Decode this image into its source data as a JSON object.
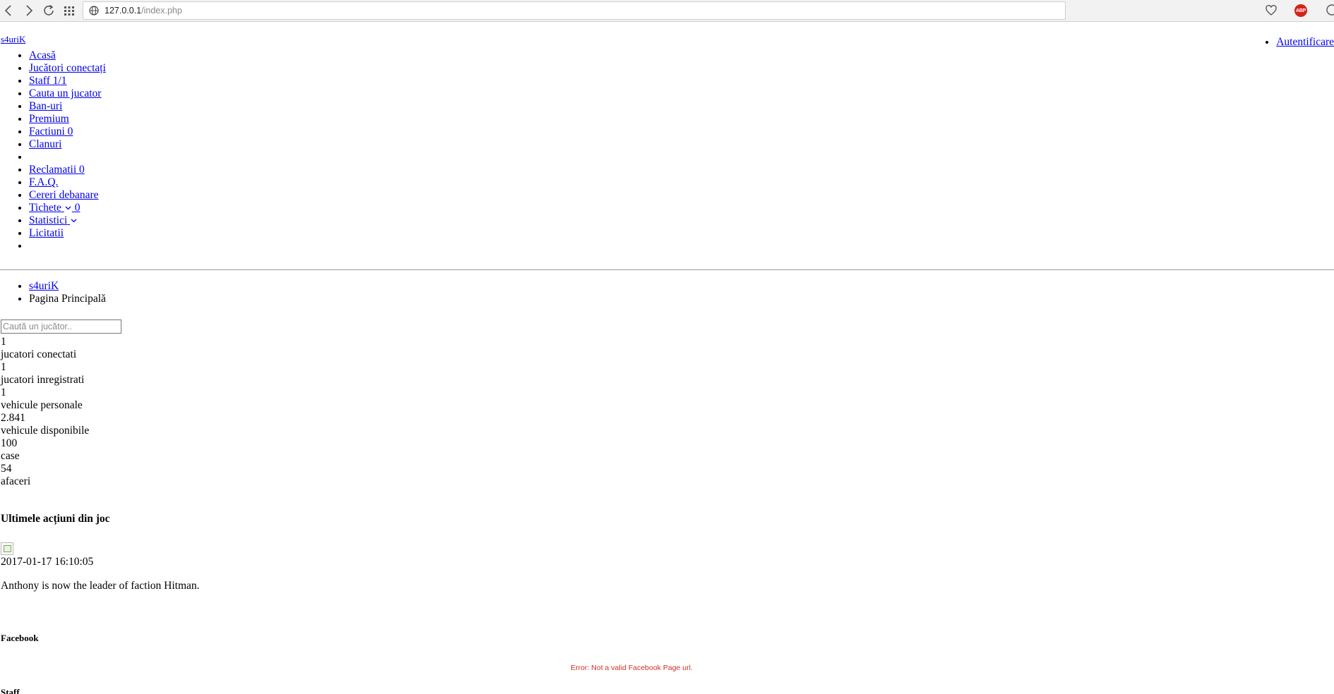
{
  "browser": {
    "url_host": "127.0.0.1",
    "url_path": "/index.php",
    "abp_label": "ABP"
  },
  "site": {
    "brand": "s4uriK",
    "login_link": "Autentificare"
  },
  "nav": {
    "items": [
      {
        "label": "Acasă"
      },
      {
        "label": "Jucători conectați"
      },
      {
        "label": "Staff 1/1"
      },
      {
        "label": "Cauta un jucator"
      },
      {
        "label": "Ban-uri"
      },
      {
        "label": "Premium"
      },
      {
        "label": "Factiuni 0"
      },
      {
        "label": "Clanuri"
      },
      {
        "label": ""
      },
      {
        "label": "Reclamatii 0"
      },
      {
        "label": "F.A.Q."
      },
      {
        "label": "Cereri debanare"
      },
      {
        "label": "Tichete",
        "count": "0"
      },
      {
        "label": "Statistici"
      },
      {
        "label": "Licitatii"
      },
      {
        "label": ""
      }
    ]
  },
  "breadcrumb": {
    "home": "s4uriK",
    "current": "Pagina Principală"
  },
  "search": {
    "placeholder": "Caută un jucător.."
  },
  "stats": [
    {
      "value": "1",
      "label": "jucatori conectati"
    },
    {
      "value": "1",
      "label": "jucatori inregistrati"
    },
    {
      "value": "1",
      "label": "vehicule personale"
    },
    {
      "value": "2.841",
      "label": "vehicule disponibile"
    },
    {
      "value": "100",
      "label": "case"
    },
    {
      "value": "54",
      "label": "afaceri"
    }
  ],
  "recent_actions": {
    "title": "Ultimele acțiuni din joc",
    "timestamp": "2017-01-17 16:10:05",
    "message": "Anthony is now the leader of faction Hitman."
  },
  "facebook": {
    "title": "Facebook",
    "error": "Error: Not a valid Facebook Page url."
  },
  "staff": {
    "title": "Staff"
  }
}
